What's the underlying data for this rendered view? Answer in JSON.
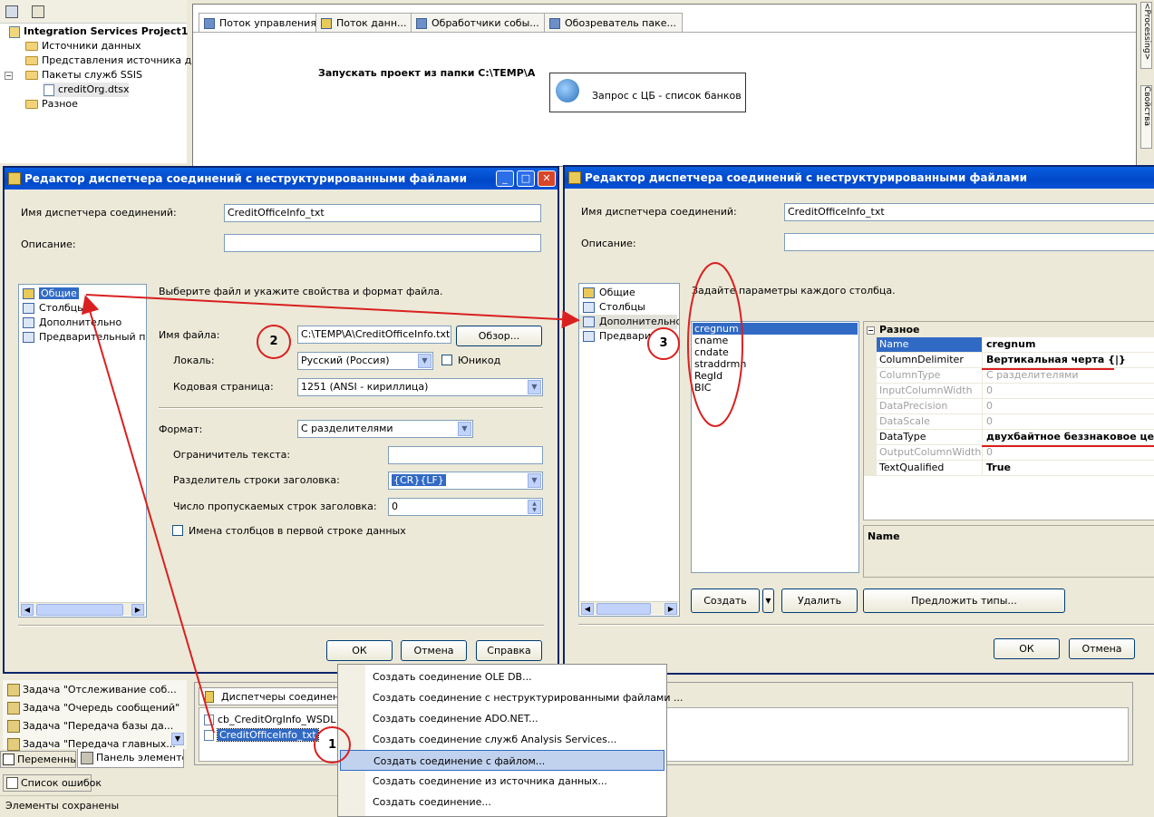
{
  "solution": {
    "project": "Integration Services Project1",
    "items": [
      {
        "label": "Источники данных",
        "icon": "folder-icon"
      },
      {
        "label": "Представления источника дан",
        "icon": "folder-icon"
      },
      {
        "label": "Пакеты служб SSIS",
        "icon": "folder-icon"
      },
      {
        "label": "creditOrg.dtsx",
        "icon": "package-icon"
      },
      {
        "label": "Разное",
        "icon": "folder-icon"
      }
    ]
  },
  "designer": {
    "tabs": [
      "Поток управления",
      "Поток данн...",
      "Обработчики собы...",
      "Обозреватель паке..."
    ],
    "annotation": "Запускать проект из папки C:\\TEMP\\A",
    "task": "Запрос с ЦБ - список банков",
    "side_tabs": [
      "<Processing>",
      "Свойства"
    ]
  },
  "dialog_left": {
    "title": "Редактор диспетчера соединений с неструктурированными файлами",
    "conn_name_label": "Имя диспетчера соединений:",
    "conn_name_value": "CreditOfficeInfo_txt",
    "desc_label": "Описание:",
    "nav": [
      "Общие",
      "Столбцы",
      "Дополнительно",
      "Предварительный прс"
    ],
    "hint": "Выберите файл и укажите свойства и формат файла.",
    "file_label": "Имя файла:",
    "file_value": "C:\\TEMP\\A\\CreditOfficeInfo.txt",
    "browse": "Обзор...",
    "locale_label": "Локаль:",
    "locale_value": "Русский (Россия)",
    "unicode_label": "Юникод",
    "codepage_label": "Кодовая страница:",
    "codepage_value": "1251  (ANSI - кириллица)",
    "format_label": "Формат:",
    "format_value": "С разделителями",
    "text_qual_label": "Ограничитель текста:",
    "header_delim_label": "Разделитель строки заголовка:",
    "header_delim_value": "{CR}{LF}",
    "skip_rows_label": "Число пропускаемых строк заголовка:",
    "skip_rows_value": "0",
    "colnames_label": "Имена столбцов в первой строке данных",
    "ok": "ОК",
    "cancel": "Отмена",
    "help": "Справка"
  },
  "dialog_right": {
    "title": "Редактор диспетчера соединений с неструктурированными файлами",
    "conn_name_label": "Имя диспетчера соединений:",
    "conn_name_value": "CreditOfficeInfo_txt",
    "desc_label": "Описание:",
    "nav": [
      "Общие",
      "Столбцы",
      "Дополнительно",
      "Предвари"
    ],
    "hint": "Задайте параметры каждого столбца.",
    "columns": [
      "cregnum",
      "cname",
      "cndate",
      "straddrmn",
      "RegId",
      "BIC"
    ],
    "category": "Разное",
    "props": [
      {
        "name": "Name",
        "value": "cregnum",
        "dim": false
      },
      {
        "name": "ColumnDelimiter",
        "value": "Вертикальная черта {|}",
        "dim": false
      },
      {
        "name": "ColumnType",
        "value": "С разделителями",
        "dim": true
      },
      {
        "name": "InputColumnWidth",
        "value": "0",
        "dim": true
      },
      {
        "name": "DataPrecision",
        "value": "0",
        "dim": true
      },
      {
        "name": "DataScale",
        "value": "0",
        "dim": true
      },
      {
        "name": "DataType",
        "value": "двухбайтное беззнаковое целое",
        "dim": false
      },
      {
        "name": "OutputColumnWidth",
        "value": "0",
        "dim": true
      },
      {
        "name": "TextQualified",
        "value": "True",
        "dim": false
      }
    ],
    "desc_title": "Name",
    "create": "Создать",
    "delete": "Удалить",
    "suggest": "Предложить типы...",
    "ok": "ОК",
    "cancel": "Отмена"
  },
  "toolbox": {
    "items": [
      "Задача \"Отслеживание соб...",
      "Задача \"Очередь сообщений\"",
      "Задача \"Передача базы да...",
      "Задача \"Передача главных..."
    ],
    "tab_vars": "Переменные",
    "tab_toolbox": "Панель элементов"
  },
  "conn_managers": {
    "tab": "Диспетчеры соединений",
    "items": [
      "cb_CreditOrgInfo_WSDL",
      "CreditOfficeInfo_txt"
    ]
  },
  "context_menu": [
    "Создать соединение OLE DB...",
    "Создать соединение с неструктурированными файлами ...",
    "Создать соединение ADO.NET...",
    "Создать соединение служб Analysis Services...",
    "Создать соединение с файлом...",
    "Создать соединение из источника данных...",
    "Создать соединение..."
  ],
  "error_list": "Список ошибок",
  "status": "Элементы сохранены",
  "annotations": [
    "1",
    "2",
    "3"
  ],
  "colors": {
    "title": "#0a5fe0",
    "selection": "#316ac5",
    "annotation": "#d92020"
  }
}
